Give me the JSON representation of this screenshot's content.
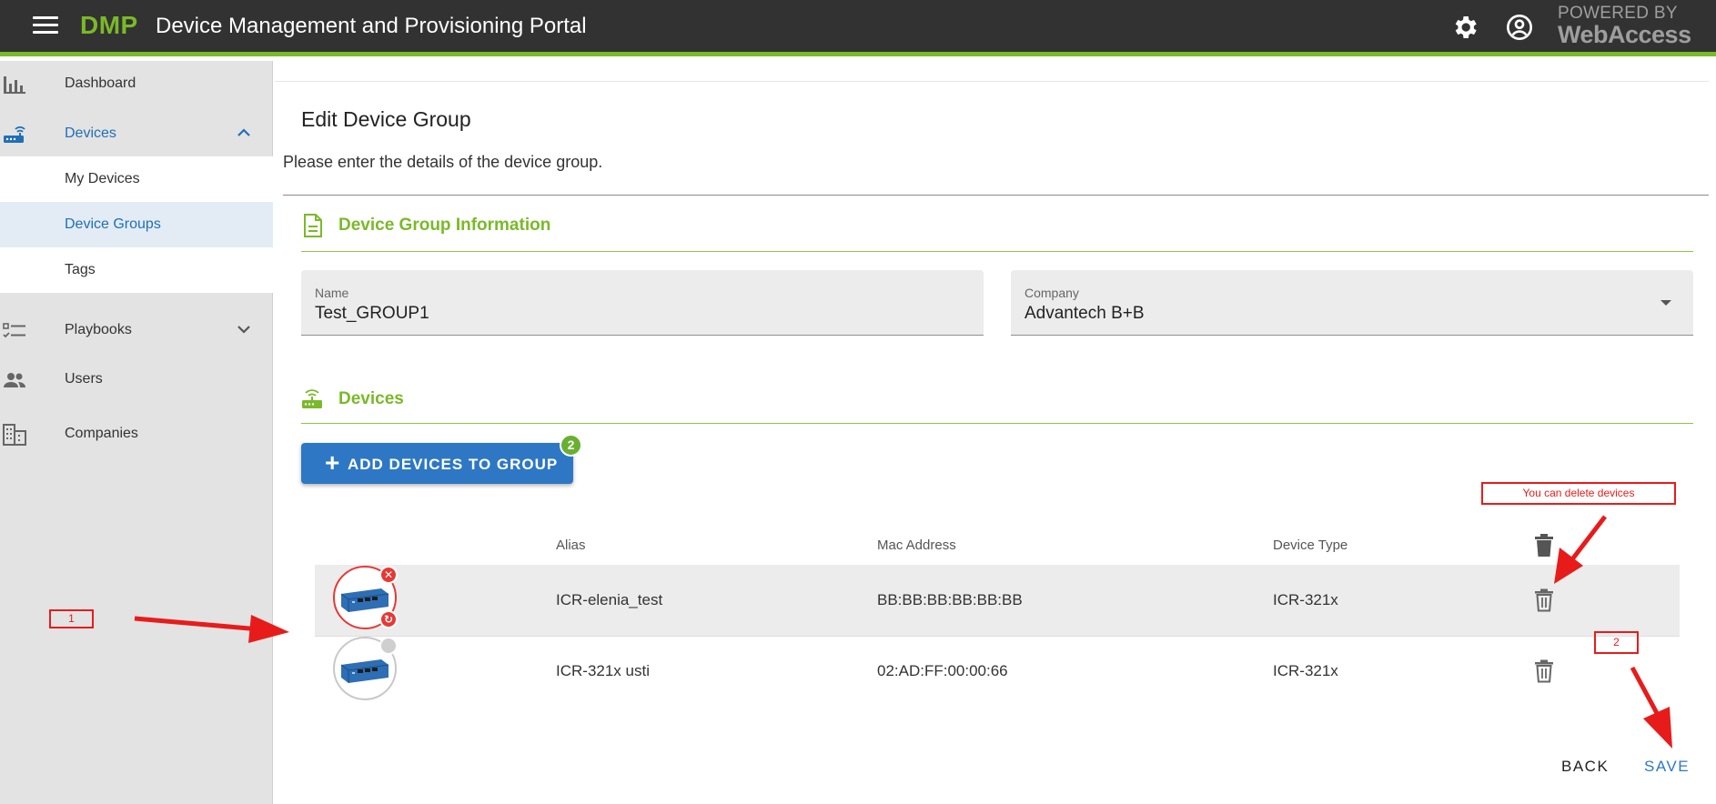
{
  "header": {
    "brand": "DMP",
    "title": "Device Management and Provisioning Portal",
    "powered_line1": "POWERED BY",
    "powered_line2": "WebAccess",
    "accent_color": "#7ab929",
    "icons": [
      "menu-icon",
      "settings-icon",
      "account-icon"
    ]
  },
  "sidebar": {
    "items": [
      {
        "label": "Dashboard",
        "icon": "bar-chart-icon"
      },
      {
        "label": "Devices",
        "icon": "router-icon",
        "expanded": true
      },
      {
        "label": "Playbooks",
        "icon": "checklist-icon"
      },
      {
        "label": "Users",
        "icon": "people-icon"
      },
      {
        "label": "Companies",
        "icon": "building-icon"
      }
    ],
    "devices_subitems": [
      {
        "label": "My Devices"
      },
      {
        "label": "Device Groups",
        "active": true
      },
      {
        "label": "Tags"
      }
    ],
    "annotation_1": "1"
  },
  "main": {
    "title": "Edit Device Group",
    "subtitle": "Please enter the details of the device group.",
    "info_section": {
      "title": "Device Group Information",
      "name_label": "Name",
      "name_value": "Test_GROUP1",
      "company_label": "Company",
      "company_value": "Advantech B+B"
    },
    "devices_section": {
      "title": "Devices",
      "add_button": "ADD DEVICES TO GROUP",
      "badge_count": "2"
    },
    "table": {
      "columns": [
        "Alias",
        "Mac Address",
        "Device Type"
      ],
      "rows": [
        {
          "alias": "ICR-elenia_test",
          "mac": "BB:BB:BB:BB:BB:BB",
          "type": "ICR-321x",
          "status": "error"
        },
        {
          "alias": "ICR-321x usti",
          "mac": "02:AD:FF:00:00:66",
          "type": "ICR-321x",
          "status": "offline"
        }
      ]
    },
    "annotation_delete": "You can delete devices",
    "annotation_2": "2",
    "back_label": "BACK",
    "save_label": "SAVE"
  }
}
